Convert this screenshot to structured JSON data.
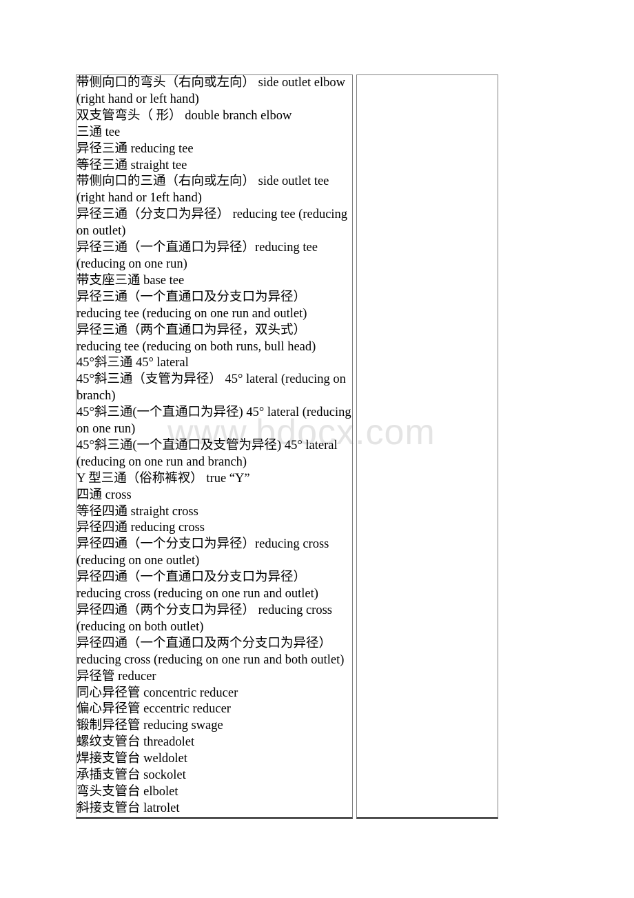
{
  "document": {
    "page_background": "#ffffff",
    "text_color": "#000000",
    "border_color": "#7f7f7f",
    "bottom_border_color": "#1a1a1a"
  },
  "watermark": {
    "text": "www.bdocx.com",
    "color": "#e4e4e4"
  },
  "table": {
    "columns": 2,
    "left_column": {
      "label": "piping-fittings-terms",
      "terms": [
        "带侧向口的弯头（右向或左向） side outlet elbow (right hand or left hand)",
        "双支管弯头（ 形） double branch elbow",
        "三通 tee",
        "异径三通 reducing tee",
        "等径三通 straight tee",
        "带侧向口的三通（右向或左向） side outlet tee (right hand or 1eft hand)",
        "异径三通（分支口为异径） reducing tee (reducing on outlet)",
        "异径三通（一个直通口为异径）reducing tee (reducing on one run)",
        "带支座三通 base tee",
        "异径三通（一个直通口及分支口为异径） reducing tee (reducing on one run and outlet)",
        "异径三通（两个直通口为异径，双头式） reducing tee (reducing on both runs, bull head)",
        "45°斜三通 45° lateral",
        "45°斜三通（支管为异径） 45° lateral (reducing on branch)",
        "45°斜三通(一个直通口为异径) 45° lateral (reducing on one run)",
        "45°斜三通(一个直通口及支管为异径) 45° lateral (reducing on one run and branch)",
        "Y 型三通（俗称裤衩） true “Y”",
        "四通 cross",
        "等径四通 straight cross",
        "异径四通 reducing cross",
        "异径四通（一个分支口为异径）reducing cross (reducing on one outlet)",
        "异径四通（一个直通口及分支口为异径） reducing cross (reducing on one run and outlet)",
        "异径四通（两个分支口为异径） reducing cross (reducing on both outlet)",
        "异径四通（一个直通口及两个分支口为异径） reducing cross (reducing on one run and both outlet)",
        "异径管 reducer",
        "同心异径管 concentric reducer",
        "偏心异径管 eccentric reducer",
        "锻制异径管 reducing swage",
        "螺纹支管台 threadolet",
        "焊接支管台 weldolet",
        "承插支管台 sockolet",
        "弯头支管台 elbolet",
        "斜接支管台 latrolet"
      ]
    },
    "right_column": {
      "label": "notes-column",
      "content": ""
    }
  }
}
